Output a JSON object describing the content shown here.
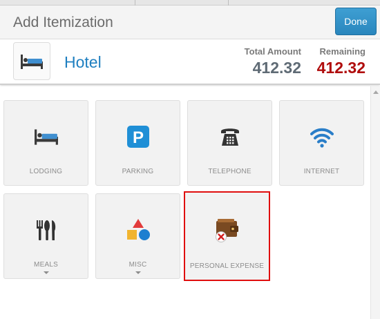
{
  "header": {
    "title": "Add Itemization",
    "done_label": "Done"
  },
  "expense": {
    "type": "Hotel",
    "icon": "bed-icon",
    "total_label": "Total Amount",
    "total_value": "412.32",
    "remaining_label": "Remaining",
    "remaining_value": "412.32",
    "remaining_color": "#b00d0d"
  },
  "categories": [
    {
      "label": "LODGING",
      "icon": "bed-icon",
      "has_dropdown": false
    },
    {
      "label": "PARKING",
      "icon": "parking-icon",
      "has_dropdown": false
    },
    {
      "label": "TELEPHONE",
      "icon": "telephone-icon",
      "has_dropdown": false
    },
    {
      "label": "INTERNET",
      "icon": "wifi-icon",
      "has_dropdown": false
    },
    {
      "label": "MEALS",
      "icon": "utensils-icon",
      "has_dropdown": true
    },
    {
      "label": "MISC",
      "icon": "shapes-icon",
      "has_dropdown": true
    },
    {
      "label": "PERSONAL EXPENSE",
      "icon": "wallet-remove-icon",
      "has_dropdown": false,
      "highlighted": true
    }
  ],
  "colors": {
    "accent": "#2a86bd",
    "highlight_border": "#e00e0e",
    "hotel_name": "#1e7fc0"
  }
}
